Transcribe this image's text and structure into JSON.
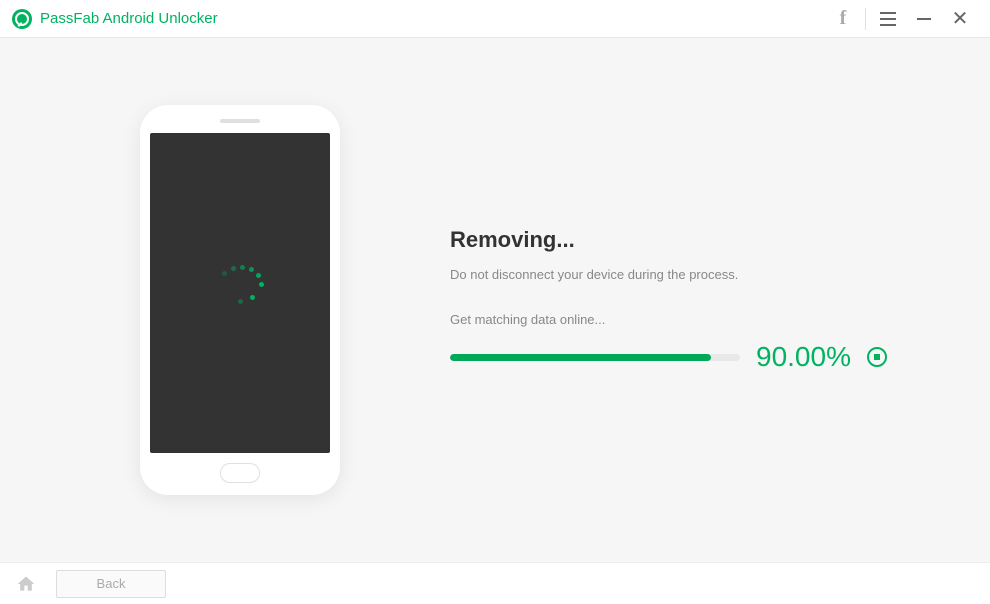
{
  "titlebar": {
    "app_name": "PassFab Android Unlocker"
  },
  "main": {
    "heading": "Removing...",
    "subtext": "Do not disconnect your device during the process.",
    "status": "Get matching data online...",
    "progress_percent": 90,
    "percent_label": "90.00%"
  },
  "footer": {
    "back_label": "Back"
  },
  "colors": {
    "accent": "#00b360"
  }
}
